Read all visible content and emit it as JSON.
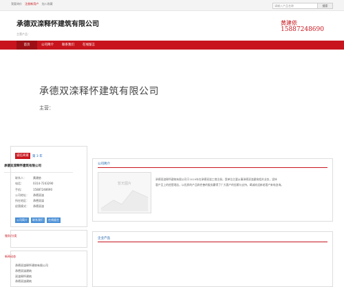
{
  "topbar": {
    "links": [
      "我要询价",
      "联系我们",
      "加入收藏"
    ],
    "register": "注册新用户",
    "search_placeholder": "请输入产品名称",
    "search_button": "搜索"
  },
  "header": {
    "company_name": "承德双滦释怀建筑有限公司",
    "subtitle": "主营产品：",
    "contact_name": "黄建依",
    "contact_phone": "15887248690"
  },
  "nav": {
    "items": [
      {
        "label": "首页",
        "active": true
      },
      {
        "label": "公司简介",
        "active": false
      },
      {
        "label": "联系我们",
        "active": false
      },
      {
        "label": "在线留言",
        "active": false
      }
    ]
  },
  "banner": {
    "title": "承德双滦释怀建筑有限公司",
    "main_label": "主营："
  },
  "sidebar": {
    "badge": "诚信商家",
    "years": "第 3 年",
    "company": "承德双滦释怀建筑有限公司",
    "info": [
      {
        "key": "联系人：",
        "value": "黄建依"
      },
      {
        "key": "电话：",
        "value": "0314-7243290"
      },
      {
        "key": "手机：",
        "value": "15887248690"
      },
      {
        "key": "公司地址：",
        "value": "承德双滦"
      },
      {
        "key": "所在地区：",
        "value": "承德双滦"
      },
      {
        "key": "经营模式：",
        "value": "承德双滦"
      }
    ],
    "buttons": [
      "公司简介",
      "联系我们",
      "在线留言"
    ],
    "category_title": "服务/分类",
    "news_title": "新闻动态",
    "links": [
      "承德双滦释怀建筑有限公司",
      "承德双滦建筑",
      "双滦释怀建筑",
      "承德双滦建筑",
      "承德双滦释怀"
    ]
  },
  "intro": {
    "title": "公司简介",
    "placeholder": "暂无图片",
    "lines": [
      "承德双滦释怀建筑有限公司于2019年在承德双滦工商注册，我单位主要从事承德双滦建筑相关业务，坚持",
      "客户至上的经营理念，以优质的产品和完善的服务赢得了广大客户的信赖与支持，竭诚欢迎新老客户来电咨询。"
    ]
  },
  "products": {
    "title": "企业产品"
  }
}
